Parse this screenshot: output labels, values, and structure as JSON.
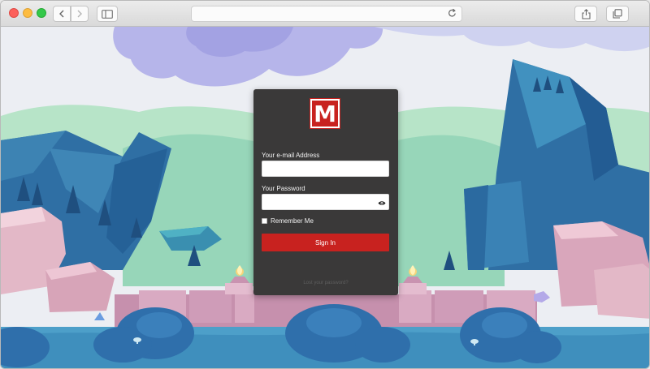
{
  "browser": {
    "icons": {
      "back": "chevron-left-icon",
      "forward": "chevron-right-icon",
      "sidebar": "sidebar-icon",
      "reload": "reload-icon",
      "share": "share-icon",
      "tabs": "tabs-icon",
      "new_tab": "plus-icon"
    },
    "address": ""
  },
  "login": {
    "logo_letter": "M",
    "email_label": "Your e-mail Address",
    "email_value": "",
    "password_label": "Your Password",
    "password_value": "",
    "remember_label": "Remember Me",
    "remember_checked": false,
    "signin_label": "Sign In",
    "lost_password_link": "Lost your password?"
  },
  "colors": {
    "accent": "#c8221f",
    "card": "#3a3939",
    "sky": "#eceef3",
    "cloud": "#b7b6ea"
  }
}
